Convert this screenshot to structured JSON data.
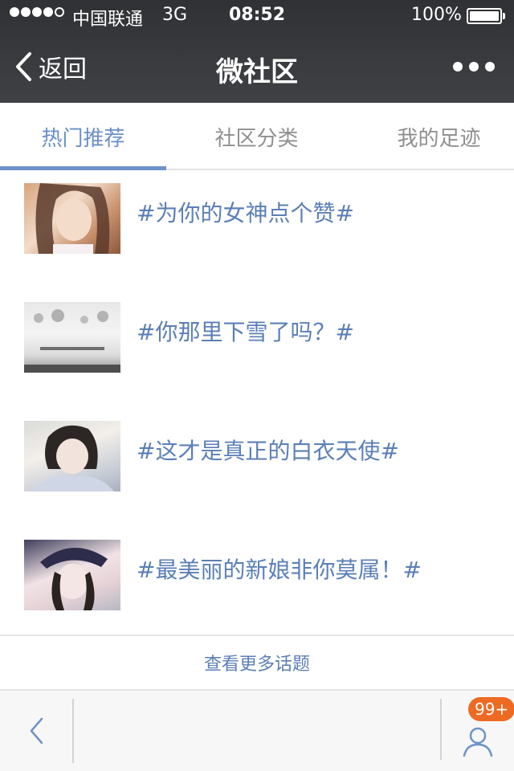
{
  "status_bar": {
    "carrier": "中国联通",
    "network": "3G",
    "time": "08:52",
    "battery": "100%",
    "signal_bars_filled": 4,
    "signal_bars_total": 5
  },
  "nav": {
    "back_label": "返回",
    "title": "微社区",
    "more_icon": "more-dots-icon"
  },
  "tabs": [
    {
      "label": "热门推荐",
      "active": true
    },
    {
      "label": "社区分类",
      "active": false
    },
    {
      "label": "我的足迹",
      "active": false
    }
  ],
  "topics": [
    {
      "title": "#为你的女神点个赞#"
    },
    {
      "title": "#你那里下雪了吗？#"
    },
    {
      "title": "#这才是真正的白衣天使#"
    },
    {
      "title": "#最美丽的新娘非你莫属！#"
    }
  ],
  "more_topics_label": "查看更多话题",
  "bottom_bar": {
    "badge": "99+",
    "back_icon": "chevron-left-icon",
    "user_icon": "user-icon"
  },
  "colors": {
    "header_bg": "#393b3f",
    "accent": "#6e93c9",
    "topic_text": "#5b7fb6",
    "badge": "#ee6a22"
  }
}
